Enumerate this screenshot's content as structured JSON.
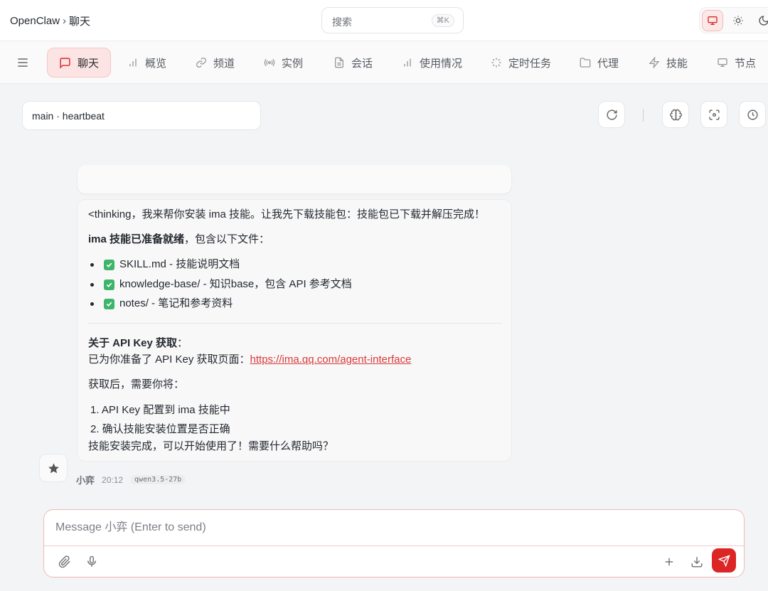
{
  "header": {
    "app": "OpenClaw",
    "separator": "›",
    "page": "聊天",
    "search_placeholder": "搜索",
    "search_shortcut": "⌘K"
  },
  "theme_toggle": {
    "options": [
      "monitor-icon",
      "sun-icon",
      "moon-icon"
    ],
    "selected": "monitor-icon"
  },
  "nav": {
    "tabs": [
      {
        "label": "聊天",
        "icon": "chat-bubble-icon",
        "active": true
      },
      {
        "label": "概览",
        "icon": "bar-chart-icon"
      },
      {
        "label": "频道",
        "icon": "link-icon"
      },
      {
        "label": "实例",
        "icon": "broadcast-icon"
      },
      {
        "label": "会话",
        "icon": "document-icon"
      },
      {
        "label": "使用情况",
        "icon": "bar-chart-icon"
      },
      {
        "label": "定时任务",
        "icon": "loader-icon"
      },
      {
        "label": "代理",
        "icon": "folder-icon"
      },
      {
        "label": "技能",
        "icon": "lightning-icon"
      },
      {
        "label": "节点",
        "icon": "monitor-icon"
      }
    ]
  },
  "session": {
    "label": "main · heartbeat"
  },
  "message": {
    "line1": "<thinking，我来帮你安装 ima 技能。让我先下载技能包：技能包已下载并解压完成！",
    "ready_bold": "ima 技能已准备就绪",
    "ready_rest": "，包含以下文件：",
    "files": [
      "SKILL.md - 技能说明文档",
      "knowledge-base/ - 知识base，包含 API 参考文档",
      "notes/ - 笔记和参考资料"
    ],
    "apikey_heading": "关于 API Key 获取",
    "apikey_colon": "：",
    "apikey_prefix": "已为你准备了 API Key 获取页面：",
    "apikey_link": "https://ima.qq.com/agent-interface",
    "after_label": "获取后，需要你将：",
    "steps": [
      "1. API Key 配置到 ima 技能中",
      "2. 确认技能安装位置是否正确"
    ],
    "closing": "技能安装完成，可以开始使用了！需要什么帮助吗？"
  },
  "sender": {
    "name": "小弈",
    "time": "20:12",
    "model": "qwen3.5-27b"
  },
  "composer": {
    "placeholder": "Message 小弈 (Enter to send)"
  },
  "colors": {
    "accent": "#dc2626",
    "accent_soft": "#fce4e4",
    "check": "#3fb56b",
    "link": "#d93a3a"
  }
}
